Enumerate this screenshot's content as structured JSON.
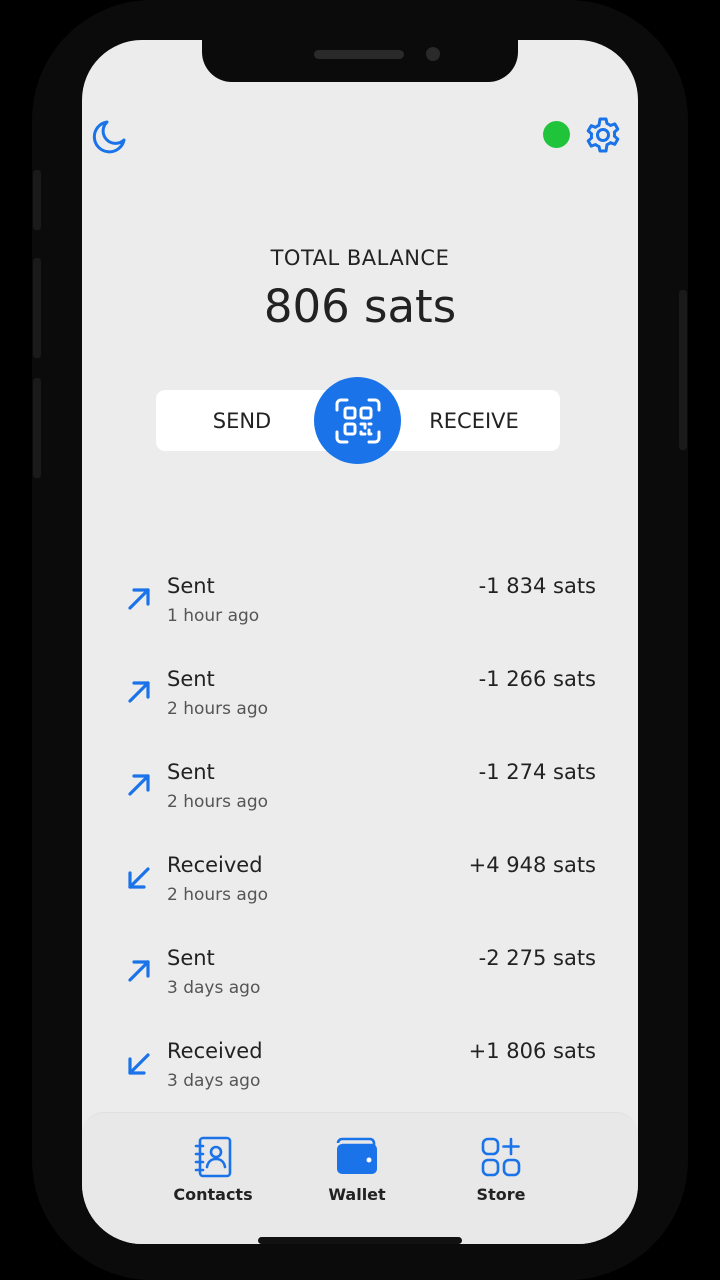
{
  "header": {
    "theme_icon": "moon-icon",
    "connection_status_color": "#1fc43a",
    "settings_icon": "gear-icon"
  },
  "balance": {
    "label": "TOTAL BALANCE",
    "value": "806 sats"
  },
  "actions": {
    "send_label": "SEND",
    "receive_label": "RECEIVE",
    "scan_icon": "qr-scan-icon"
  },
  "transactions": [
    {
      "type": "Sent",
      "time": "1 hour ago",
      "amount": "-1 834 sats",
      "direction": "outgoing"
    },
    {
      "type": "Sent",
      "time": "2 hours ago",
      "amount": "-1 266 sats",
      "direction": "outgoing"
    },
    {
      "type": "Sent",
      "time": "2 hours ago",
      "amount": "-1 274 sats",
      "direction": "outgoing"
    },
    {
      "type": "Received",
      "time": "2 hours ago",
      "amount": "+4 948 sats",
      "direction": "incoming"
    },
    {
      "type": "Sent",
      "time": "3 days ago",
      "amount": "-2 275 sats",
      "direction": "outgoing"
    },
    {
      "type": "Received",
      "time": "3 days ago",
      "amount": "+1 806 sats",
      "direction": "incoming"
    }
  ],
  "nav": {
    "contacts_label": "Contacts",
    "wallet_label": "Wallet",
    "store_label": "Store"
  },
  "colors": {
    "accent": "#1a73e8",
    "background": "#ececec"
  }
}
